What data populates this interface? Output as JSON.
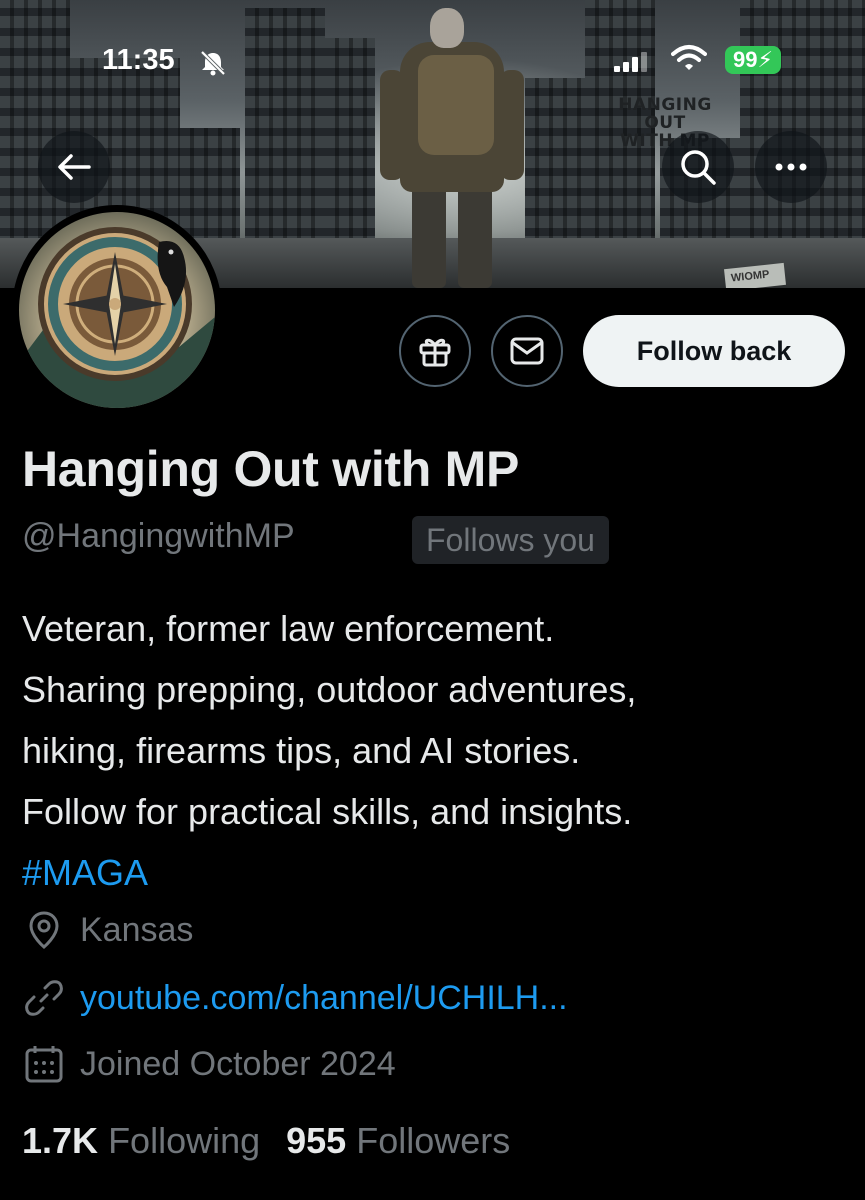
{
  "status_bar": {
    "time": "11:35",
    "battery": "99",
    "icons": [
      "bell-slash-icon",
      "signal-icon",
      "wifi-icon",
      "battery-charging-icon"
    ]
  },
  "banner": {
    "title_line1": "HANGING OUT",
    "title_line2": "WITH MP",
    "sign_text": "WIOMP"
  },
  "nav": {
    "back_icon": "arrow-left-icon",
    "search_icon": "search-icon",
    "more_icon": "more-horizontal-icon"
  },
  "actions": {
    "gift_icon": "gift-icon",
    "message_icon": "envelope-icon",
    "follow_label": "Follow back"
  },
  "profile": {
    "name": "Hanging Out with MP",
    "handle": "@HangingwithMP",
    "follows_you": "Follows you",
    "bio_lines": [
      "Veteran, former law enforcement.",
      "Sharing prepping, outdoor adventures,",
      "hiking, firearms tips, and AI stories.",
      "Follow for practical skills, and insights."
    ],
    "hashtag": "#MAGA",
    "location": "Kansas",
    "link": "youtube.com/channel/UCHILH...",
    "joined": "Joined October 2024"
  },
  "stats": {
    "following_count": "1.7K",
    "following_label": "Following",
    "followers_count": "955",
    "followers_label": "Followers"
  },
  "colors": {
    "background": "#000000",
    "text_primary": "#e7e9ea",
    "text_secondary": "#71767b",
    "accent_blue": "#1d9bf0",
    "follow_button_bg": "#eff3f4",
    "battery_green": "#33c758"
  }
}
